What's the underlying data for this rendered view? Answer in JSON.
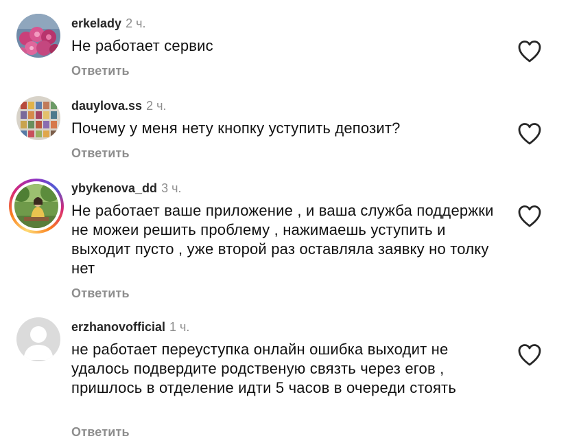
{
  "comments": [
    {
      "username": "erkelady",
      "time": "2 ч.",
      "text": "Не работает сервис",
      "reply_label": "Ответить",
      "avatar": "flowers-photo"
    },
    {
      "username": "dauylova.ss",
      "time": "2 ч.",
      "text": "Почему у меня нету кнопку уступить депозит?",
      "reply_label": "Ответить",
      "avatar": "collage-photo"
    },
    {
      "username": "ybykenova_dd",
      "time": "3 ч.",
      "text": "Не работает ваше приложение , и ваша служба поддержки не можеи решить проблему , нажимаешь уступить и выходит пусто , уже второй раз оставляла заявку но толку нет",
      "reply_label": "Ответить",
      "avatar": "park-photo",
      "has_story_ring": true
    },
    {
      "username": "erzhanovofficial",
      "time": "1 ч.",
      "text": "не работает переуступка онлайн ошибка выходит не удалось подвердите родственую связть через егов , пришлось в отделение идти 5 часов в очереди стоять",
      "reply_label": "Ответить",
      "avatar": "default-avatar"
    }
  ],
  "icons": {
    "like": "heart-outline-icon"
  },
  "colors": {
    "text": "#262626",
    "muted": "#8e8e8e",
    "default_avatar_bg": "#dbdbdb"
  }
}
